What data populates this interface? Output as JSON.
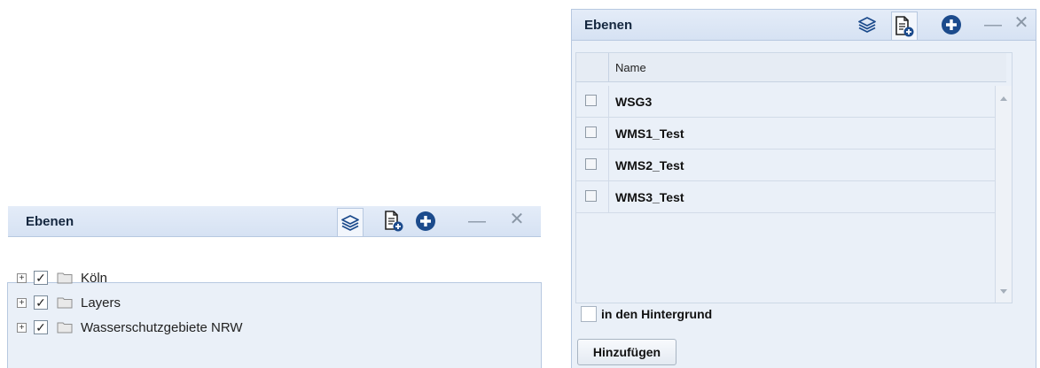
{
  "colors": {
    "header_bg": "#d6e2f3",
    "panel_bg": "#eaf0f8",
    "accent_icon": "#1c4b8c"
  },
  "left_panel": {
    "title": "Ebenen",
    "tools": [
      "layers-icon",
      "add-document-icon",
      "plus-circle-icon",
      "minimize-icon",
      "close-icon"
    ],
    "tree": [
      {
        "label": "Köln",
        "checked": true,
        "expander": "+"
      },
      {
        "label": "Layers",
        "checked": true,
        "expander": "+"
      },
      {
        "label": "Wasserschutzgebiete NRW",
        "checked": true,
        "expander": "+"
      }
    ]
  },
  "right_panel": {
    "title": "Ebenen",
    "tools": [
      "layers-icon",
      "add-document-icon",
      "plus-circle-icon",
      "minimize-icon",
      "close-icon"
    ],
    "grid": {
      "column_header": "Name",
      "rows": [
        {
          "name": "WSG3",
          "checked": false
        },
        {
          "name": "WMS1_Test",
          "checked": false
        },
        {
          "name": "WMS2_Test",
          "checked": false
        },
        {
          "name": "WMS3_Test",
          "checked": false
        }
      ]
    },
    "background_option": "in den Hintergrund",
    "add_button": "Hinzufügen"
  }
}
